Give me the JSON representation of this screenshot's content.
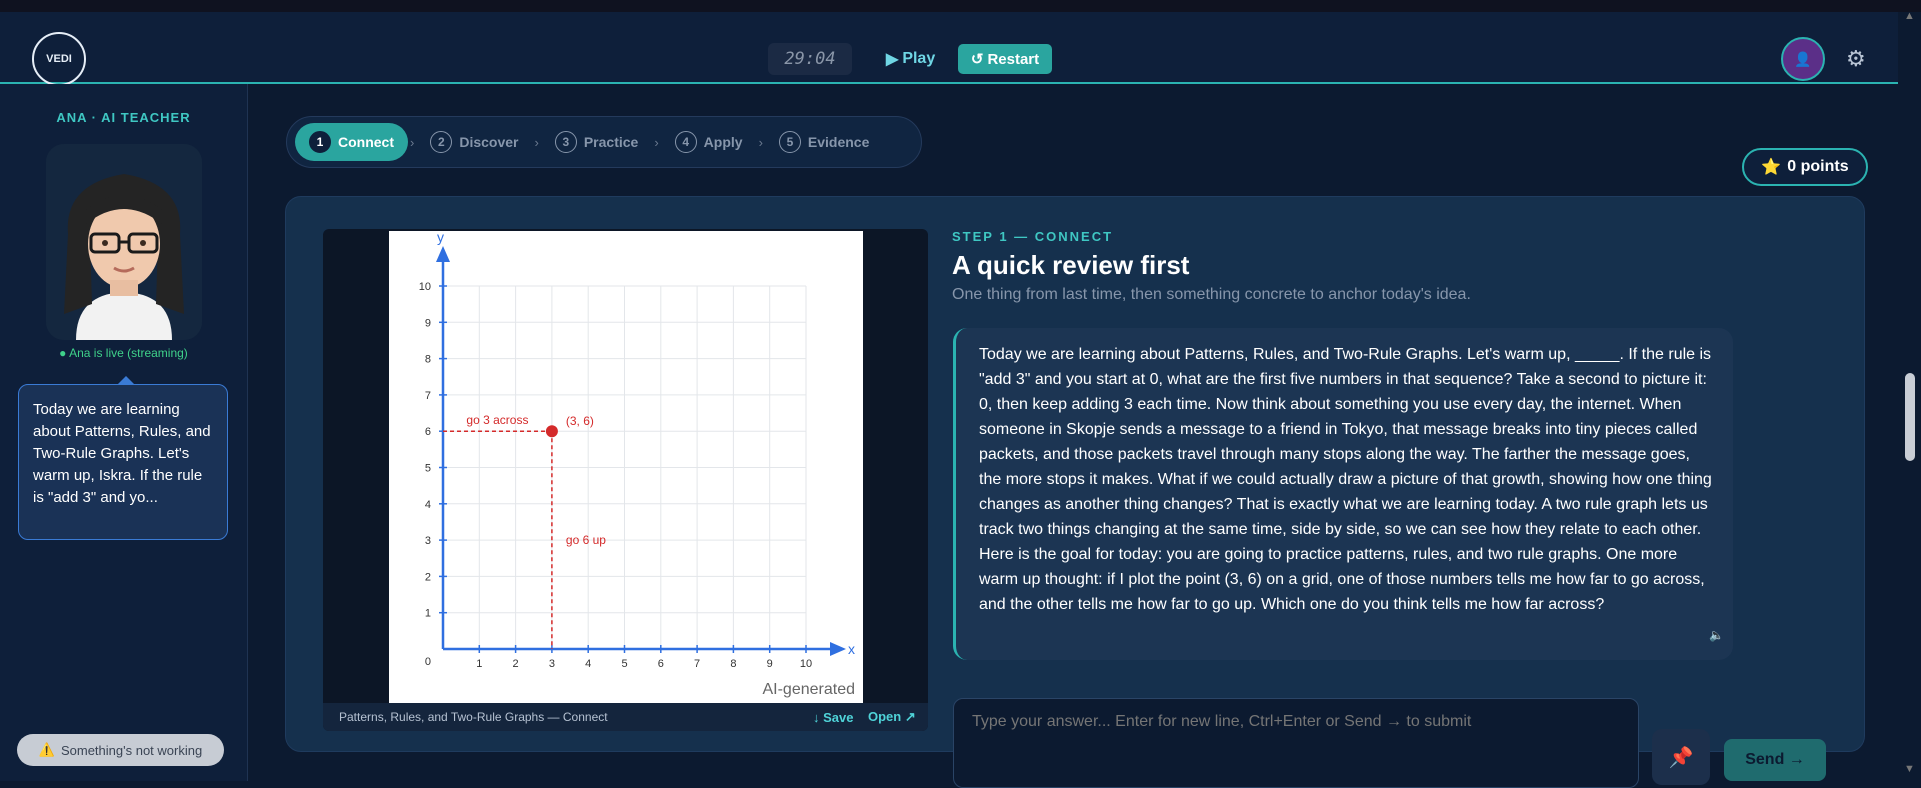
{
  "header": {
    "logo_text": "VEDI",
    "timer": "29:04",
    "play_label": "Play",
    "restart_label": "Restart"
  },
  "sidebar": {
    "teacher_label": "ANA · AI TEACHER",
    "live_status": "Ana is live (streaming)",
    "bubble_text": "Today we are learning about Patterns, Rules, and Two-Rule Graphs. Let's warm up, Iskra. If the rule is \"add 3\" and yo...",
    "bug_button": "Something's not working"
  },
  "steps": [
    {
      "num": "1",
      "label": "Connect"
    },
    {
      "num": "2",
      "label": "Discover"
    },
    {
      "num": "3",
      "label": "Practice"
    },
    {
      "num": "4",
      "label": "Apply"
    },
    {
      "num": "5",
      "label": "Evidence"
    }
  ],
  "points_label": "0 points",
  "lesson": {
    "eyebrow": "STEP 1 — CONNECT",
    "title": "A quick review first",
    "subtitle": "One thing from last time, then something concrete to anchor today's idea.",
    "message": "Today we are learning about Patterns, Rules, and Two-Rule Graphs. Let's warm up, _____. If the rule is \"add 3\" and you start at 0, what are the first five numbers in that sequence? Take a second to picture it: 0, then keep adding 3 each time. Now think about something you use every day, the internet. When someone in Skopje sends a message to a friend in Tokyo, that message breaks into tiny pieces called packets, and those packets travel through many stops along the way. The farther the message goes, the more stops it makes. What if we could actually draw a picture of that growth, showing how one thing changes as another thing changes? That is exactly what we are learning today. A two rule graph lets us track two things changing at the same time, side by side, so we can see how they relate to each other. Here is the goal for today: you are going to practice patterns, rules, and two rule graphs. One more warm up thought: if I plot the point (3, 6) on a grid, one of those numbers tells me how far to go across, and the other tells me how far to go up. Which one do you think tells me how far across?"
  },
  "image_panel": {
    "ai_label": "AI-generated",
    "caption": "Patterns, Rules, and Two-Rule Graphs — Connect",
    "save_label": "Save",
    "open_label": "Open"
  },
  "answer": {
    "placeholder": "Type your answer... Enter for new line, Ctrl+Enter or Send → to submit",
    "send_label": "Send →"
  },
  "chart_data": {
    "type": "scatter",
    "x": [
      3
    ],
    "y": [
      6
    ],
    "point_label": "(3, 6)",
    "xlabel": "x",
    "ylabel": "y",
    "xlim": [
      0,
      10
    ],
    "ylim": [
      0,
      10
    ],
    "origin_label": "0",
    "annotations": [
      "go 3 across",
      "go 6 up"
    ],
    "grid": true,
    "colors": {
      "axis": "#2f6fe0",
      "point": "#d42a2a",
      "grid": "#e3e6ea"
    }
  }
}
